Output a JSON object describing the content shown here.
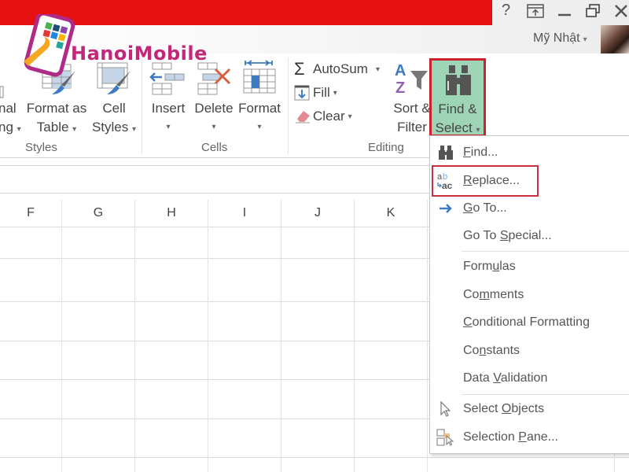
{
  "window": {
    "controls": {
      "help": "?",
      "ribbon_display": "⇪",
      "minimize": "—",
      "restore": "❐",
      "close": "✕"
    },
    "user_name": "Mỹ Nhật",
    "brand_color": "#e61212"
  },
  "watermark": {
    "text": "HanoiMobile"
  },
  "ribbon": {
    "styles_group": {
      "label": "Styles",
      "conditional_partial_1": "nal",
      "conditional_partial_2": "ng",
      "format_as_table_1": "Format as",
      "format_as_table_2": "Table",
      "cell_styles_1": "Cell",
      "cell_styles_2": "Styles"
    },
    "cells_group": {
      "label": "Cells",
      "insert": "Insert",
      "delete": "Delete",
      "format": "Format"
    },
    "editing_group": {
      "label": "Editing",
      "autosum": "AutoSum",
      "fill": "Fill",
      "clear": "Clear",
      "sort_filter_1": "Sort &",
      "sort_filter_2": "Filter",
      "find_select_1": "Find &",
      "find_select_2": "Select",
      "highlight_color": "#9fd5b7"
    }
  },
  "sheet": {
    "columns": [
      "F",
      "G",
      "H",
      "I",
      "J",
      "K"
    ]
  },
  "find_select_menu": {
    "items": [
      {
        "pre": "",
        "u": "F",
        "post": "ind...",
        "icon": "binoculars-icon"
      },
      {
        "pre": "",
        "u": "R",
        "post": "eplace...",
        "icon": "replace-icon"
      },
      {
        "pre": "",
        "u": "G",
        "post": "o To...",
        "icon": "arrow-right-icon"
      },
      {
        "pre": "Go To ",
        "u": "S",
        "post": "pecial...",
        "icon": ""
      },
      {
        "pre": "Form",
        "u": "u",
        "post": "las",
        "icon": ""
      },
      {
        "pre": "Co",
        "u": "m",
        "post": "ments",
        "icon": ""
      },
      {
        "pre": "",
        "u": "C",
        "post": "onditional Formatting",
        "icon": ""
      },
      {
        "pre": "Co",
        "u": "n",
        "post": "stants",
        "icon": ""
      },
      {
        "pre": "Data ",
        "u": "V",
        "post": "alidation",
        "icon": ""
      },
      {
        "pre": "Select ",
        "u": "O",
        "post": "bjects",
        "icon": "cursor-icon"
      },
      {
        "pre": "Selection ",
        "u": "P",
        "post": "ane...",
        "icon": "selection-pane-icon"
      }
    ]
  }
}
